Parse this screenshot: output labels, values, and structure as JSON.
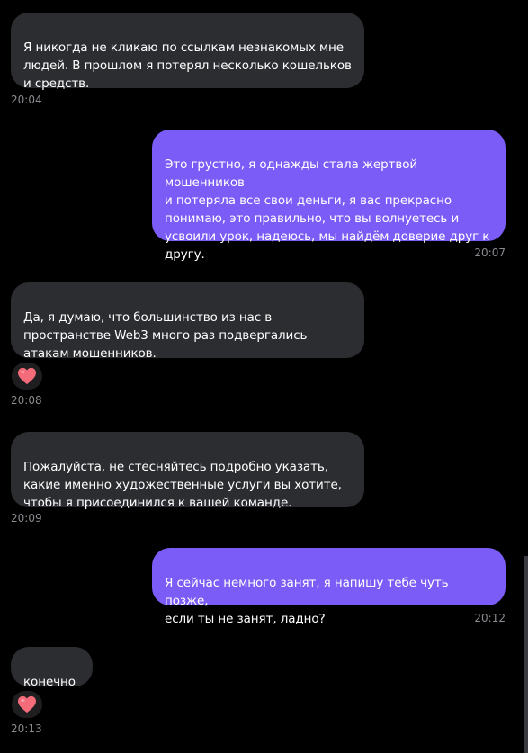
{
  "messages": [
    {
      "id": 1,
      "direction": "incoming",
      "text": "Я никогда не кликаю по ссылкам незнакомых мне\nлюдей. В прошлом я потерял несколько кошельков\nи средств.",
      "time": "20:04"
    },
    {
      "id": 2,
      "direction": "outgoing",
      "text": "Это грустно, я однажды стала жертвой мошенников\nи потеряла все свои деньги, я вас прекрасно\nпонимаю, это правильно, что вы волнуетесь и\nусвоили урок, надеюсь, мы найдём доверие друг к\nдругу.",
      "time": "20:07"
    },
    {
      "id": 3,
      "direction": "incoming",
      "text": "Да, я думаю, что большинство из нас в\nпространстве Web3 много раз подвергались\nатакам мошенников.",
      "time": "20:08",
      "reaction": "heart-icon"
    },
    {
      "id": 4,
      "direction": "incoming",
      "text": "Пожалуйста, не стесняйтесь подробно указать,\nкакие именно художественные услуги вы хотите,\nчтобы я присоединился к вашей команде.",
      "time": "20:09"
    },
    {
      "id": 5,
      "direction": "outgoing",
      "text": "Я сейчас немного занят, я напишу тебе чуть позже,\nесли ты не занят, ладно?",
      "time": "20:12"
    },
    {
      "id": 6,
      "direction": "incoming",
      "text": "конечно",
      "time": "20:13",
      "reaction": "heart-icon"
    }
  ],
  "colors": {
    "background": "#000000",
    "incoming_bubble": "#2c2d31",
    "outgoing_bubble": "#7b5cf6",
    "timestamp": "#8a8b90",
    "heart": "#f46b7a"
  }
}
